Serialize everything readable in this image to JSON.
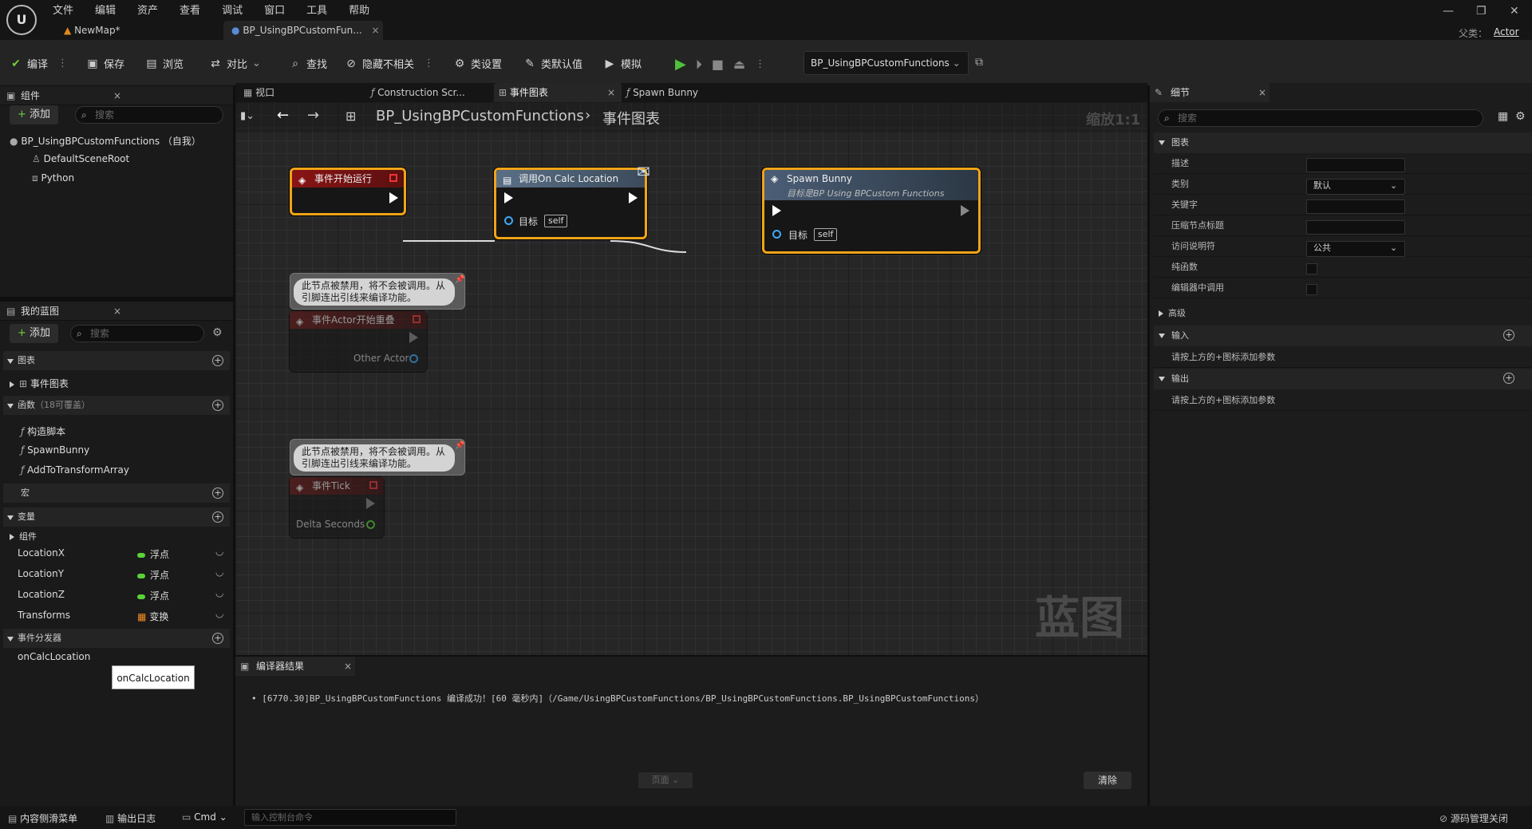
{
  "menu": [
    "文件",
    "编辑",
    "资产",
    "查看",
    "调试",
    "窗口",
    "工具",
    "帮助"
  ],
  "doc_tabs": [
    "NewMap*",
    "BP_UsingBPCustomFun..."
  ],
  "parent_label": "父类：",
  "parent_value": "Actor",
  "toolbar": {
    "compile": "编译",
    "save": "保存",
    "browse": "浏览",
    "diff": "对比",
    "find": "查找",
    "hide": "隐藏不相关",
    "class_settings": "类设置",
    "class_defaults": "类默认值",
    "simulate": "模拟",
    "debug_object": "BP_UsingBPCustomFunctions"
  },
  "components": {
    "title": "组件",
    "add": "添加",
    "search_placeholder": "搜索",
    "root": "BP_UsingBPCustomFunctions （自我）",
    "items": [
      "DefaultSceneRoot",
      "Python"
    ]
  },
  "my_blueprint": {
    "title": "我的蓝图",
    "add": "添加",
    "search_placeholder": "搜索",
    "sections": {
      "graphs": "图表",
      "functions": "函数",
      "functions_note": "（18可覆盖）",
      "macros": "宏",
      "variables": "变量",
      "dispatchers": "事件分发器"
    },
    "graph_items": [
      "事件图表"
    ],
    "function_items": [
      "构造脚本",
      "SpawnBunny",
      "AddToTransformArray"
    ],
    "component_group": "组件",
    "variables": [
      {
        "name": "LocationX",
        "type": "浮点",
        "color": "#5ad138"
      },
      {
        "name": "LocationY",
        "type": "浮点",
        "color": "#5ad138"
      },
      {
        "name": "LocationZ",
        "type": "浮点",
        "color": "#5ad138"
      },
      {
        "name": "Transforms",
        "type": "变换",
        "color": "#f08a24"
      }
    ],
    "dispatcher_items": [
      "onCalcLocation"
    ],
    "tooltip": "onCalcLocation"
  },
  "graph_tabs": [
    "视口",
    "Construction Scr...",
    "事件图表",
    "Spawn Bunny"
  ],
  "breadcrumb": {
    "bp": "BP_UsingBPCustomFunctions",
    "graph": "事件图表",
    "zoom": "缩放1:1"
  },
  "nodes": {
    "begin": "事件开始运行",
    "call": "调用On Calc Location",
    "call_target": "目标",
    "call_self": "self",
    "spawn": "Spawn Bunny",
    "spawn_sub": "目标是BP Using BPCustom Functions",
    "spawn_target": "目标",
    "spawn_self": "self",
    "disabled_comment": "此节点被禁用，将不会被调用。从引脚连出引线来编译功能。",
    "overlap": "事件Actor开始重叠",
    "overlap_pin": "Other Actor",
    "tick": "事件Tick",
    "tick_pin": "Delta Seconds"
  },
  "watermark": "蓝图",
  "compiler": {
    "title": "编译器结果",
    "message": "[6770.30]BP_UsingBPCustomFunctions 编译成功！[60 毫秒内]（/Game/UsingBPCustomFunctions/BP_UsingBPCustomFunctions.BP_UsingBPCustomFunctions）",
    "page": "页面",
    "clear": "清除"
  },
  "details": {
    "title": "细节",
    "search_placeholder": "搜索",
    "graph_section": "图表",
    "rows": [
      {
        "label": "描述",
        "value": ""
      },
      {
        "label": "类别",
        "value": "默认"
      },
      {
        "label": "关键字",
        "value": ""
      },
      {
        "label": "压缩节点标题",
        "value": ""
      },
      {
        "label": "访问说明符",
        "value": "公共"
      },
      {
        "label": "纯函数",
        "value": ""
      },
      {
        "label": "编辑器中调用",
        "value": ""
      }
    ],
    "advanced": "高级",
    "inputs": "输入",
    "inputs_hint": "请按上方的+图标添加参数",
    "outputs": "输出",
    "outputs_hint": "请按上方的+图标添加参数"
  },
  "status": {
    "content_drawer": "内容侧滑菜单",
    "output_log": "输出日志",
    "cmd": "Cmd",
    "console_placeholder": "输入控制台命令",
    "source_control": "源码管理关闭"
  }
}
